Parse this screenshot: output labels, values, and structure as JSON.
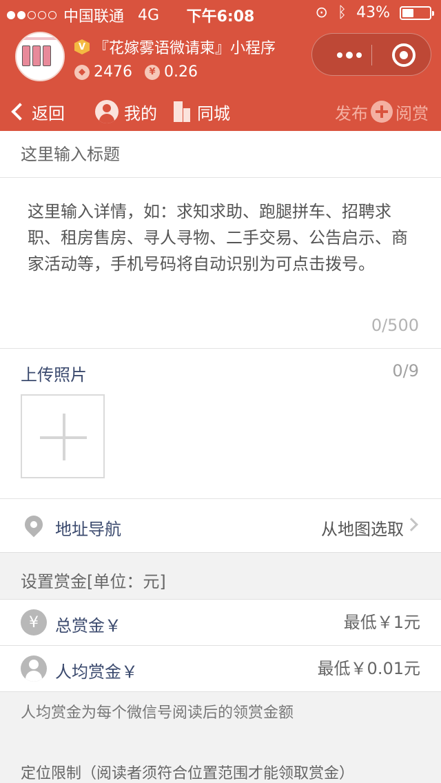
{
  "status_bar": {
    "carrier": "中国联通",
    "network": "4G",
    "time": "下午6:08",
    "battery": "43%",
    "battery_level": 0.43
  },
  "header": {
    "app_name": "『花嫁雾语微请柬』小程序",
    "vip_badge": "V",
    "stat_points": "2476",
    "stat_money": "0.26",
    "points_icon": "diamond-icon",
    "money_symbol": "¥",
    "nav": {
      "back_label": "返回",
      "me_label": "我的",
      "city_label": "同城",
      "publish_label": "发布",
      "reward_read_label": "阅赏"
    }
  },
  "form": {
    "title_placeholder": "这里输入标题",
    "detail_placeholder": "这里输入详情，如：求知求助、跑腿拼车、招聘求职、租房售房、寻人寻物、二手交易、公告启示、商家活动等，手机号码将自动识别为可点击拨号。",
    "detail_count": "0/500",
    "upload_label": "上传照片",
    "upload_count": "0/9",
    "address_label": "地址导航",
    "address_pick": "从地图选取"
  },
  "reward": {
    "section_title": "设置赏金[单位：元]",
    "total_label": "总赏金￥",
    "total_placeholder": "最低￥1元",
    "total_icon_symbol": "¥",
    "per_label": "人均赏金￥",
    "per_placeholder": "最低￥0.01元",
    "note": "人均赏金为每个微信号阅读后的领赏金额",
    "location_limit": "定位限制（阅读者须符合位置范围才能领取赏金）"
  },
  "colors": {
    "brand": "#d9533e",
    "label": "#3b4a6e"
  }
}
